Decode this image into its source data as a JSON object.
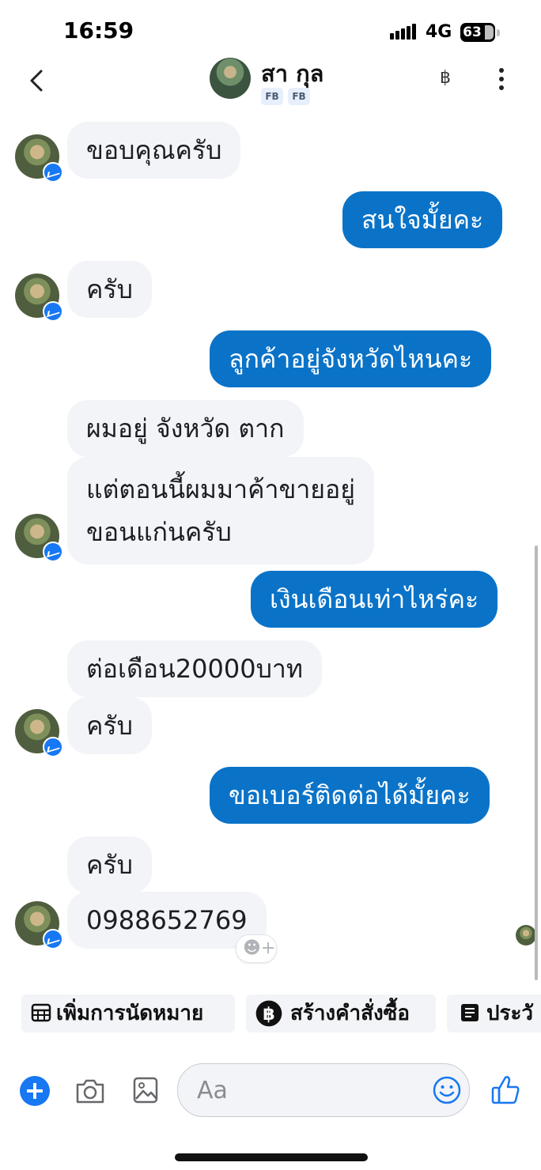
{
  "status_bar": {
    "time": "16:59",
    "network": "4G",
    "battery": "63"
  },
  "header": {
    "contact_name": "สา กุล",
    "tags": [
      "FB",
      "FB"
    ],
    "baht_icon": "฿"
  },
  "messages": [
    {
      "side": "in",
      "text": "ขอบคุณครับ"
    },
    {
      "side": "out",
      "text": "สนใจมั้ยคะ"
    },
    {
      "side": "in",
      "text": "ครับ"
    },
    {
      "side": "out",
      "text": "ลูกค้าอยู่จังหวัดไหนคะ"
    },
    {
      "side": "in",
      "text": "ผมอยู่ จังหวัด ตาก"
    },
    {
      "side": "in",
      "lines": [
        "แต่ตอนนี้ผมมาค้าขายอยู่",
        "ขอนแก่นครับ"
      ]
    },
    {
      "side": "out",
      "text": "เงินเดือนเท่าไหร่คะ"
    },
    {
      "side": "in",
      "text": "ต่อเดือน20000บาท"
    },
    {
      "side": "in",
      "text": "ครับ"
    },
    {
      "side": "out",
      "text": "ขอเบอร์ติดต่อได้มั้ยคะ"
    },
    {
      "side": "in",
      "text": "ครับ"
    },
    {
      "side": "in",
      "text": "0988652769"
    }
  ],
  "quick_actions": [
    {
      "label": "เพิ่มการนัดหมาย",
      "icon": "calendar-icon"
    },
    {
      "label": "สร้างคำสั่งซื้อ",
      "icon": "baht-circle-icon"
    },
    {
      "label": "ประวั",
      "icon": "document-icon"
    }
  ],
  "composer": {
    "placeholder": "Aa"
  },
  "colors": {
    "outgoing": "#0a73c8",
    "incoming": "#f2f4f7",
    "accent": "#1877f2"
  }
}
